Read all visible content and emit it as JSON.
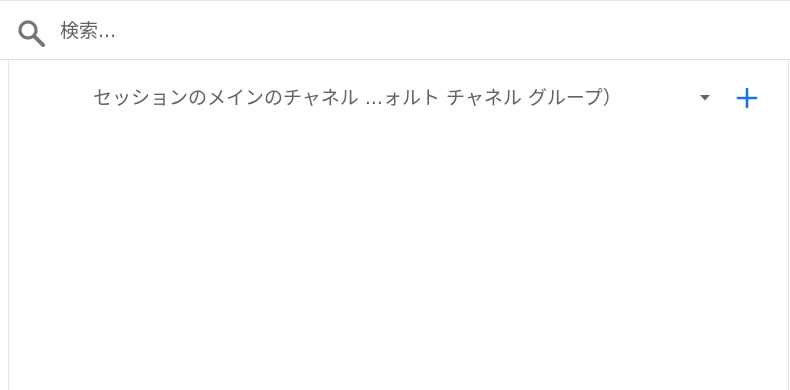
{
  "search": {
    "placeholder": "検索..."
  },
  "dimension": {
    "label": "セッションのメインのチャネル ...ォルト チャネル グループ）"
  },
  "icons": {
    "search": "search-icon",
    "dropdown": "caret-down-icon",
    "add": "plus-icon"
  },
  "colors": {
    "text": "#5f6368",
    "icon_gray": "#757575",
    "accent": "#1a73e8",
    "border": "#e0e0e0"
  }
}
